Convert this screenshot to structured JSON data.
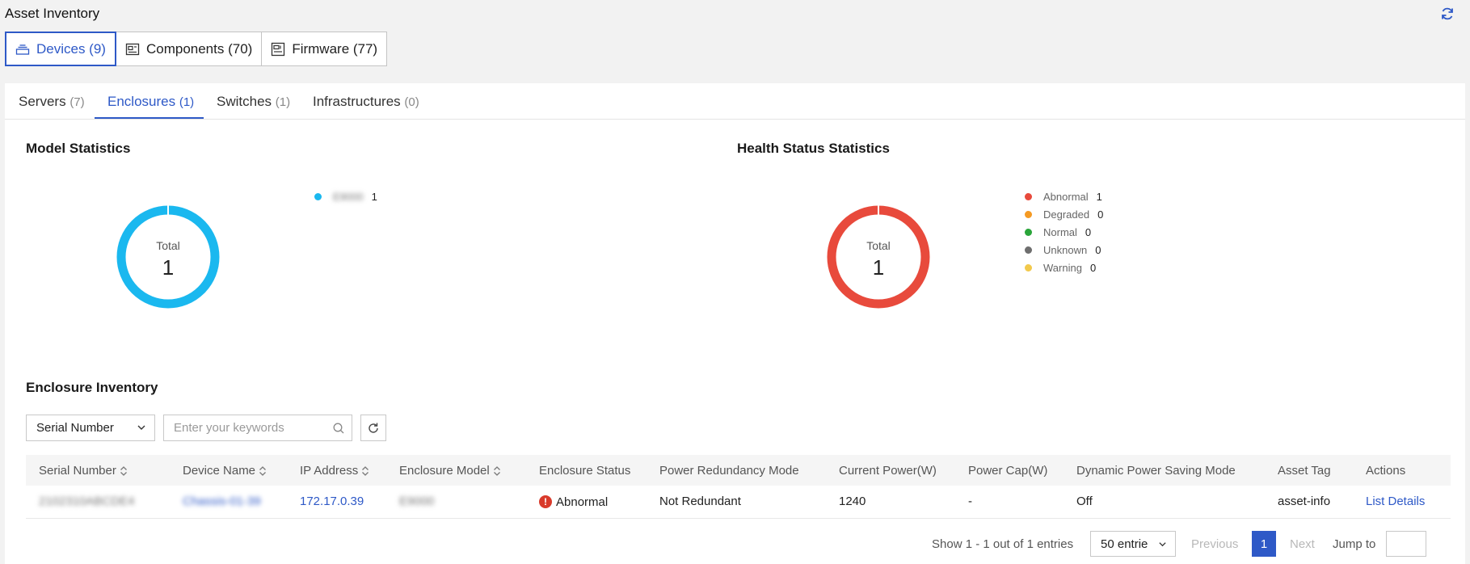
{
  "header": {
    "title": "Asset Inventory",
    "refresh_icon": "refresh-icon"
  },
  "top_tabs": [
    {
      "label": "Devices (9)",
      "icon": "devices-icon",
      "active": true
    },
    {
      "label": "Components (70)",
      "icon": "components-icon",
      "active": false
    },
    {
      "label": "Firmware (77)",
      "icon": "firmware-icon",
      "active": false
    }
  ],
  "sub_tabs": [
    {
      "label": "Servers",
      "count": "(7)",
      "active": false
    },
    {
      "label": "Enclosures",
      "count": "(1)",
      "active": true
    },
    {
      "label": "Switches",
      "count": "(1)",
      "active": false
    },
    {
      "label": "Infrastructures",
      "count": "(0)",
      "active": false
    }
  ],
  "model_stats": {
    "title": "Model Statistics",
    "total_label": "Total",
    "total_value": "1",
    "legend": [
      {
        "name": "E9000",
        "value": "1",
        "color": "#1ab8ef"
      }
    ]
  },
  "health_stats": {
    "title": "Health Status Statistics",
    "total_label": "Total",
    "total_value": "1",
    "legend": [
      {
        "name": "Abnormal",
        "value": "1",
        "color": "#e84a3c"
      },
      {
        "name": "Degraded",
        "value": "0",
        "color": "#f59a23"
      },
      {
        "name": "Normal",
        "value": "0",
        "color": "#2aa53a"
      },
      {
        "name": "Unknown",
        "value": "0",
        "color": "#6e6e6e"
      },
      {
        "name": "Warning",
        "value": "0",
        "color": "#f2c94c"
      }
    ]
  },
  "inventory": {
    "title": "Enclosure Inventory",
    "filter_field": "Serial Number",
    "search_placeholder": "Enter your keywords",
    "columns": [
      {
        "label": "Serial Number",
        "sortable": true
      },
      {
        "label": "Device Name",
        "sortable": true
      },
      {
        "label": "IP Address",
        "sortable": true
      },
      {
        "label": "Enclosure Model",
        "sortable": true
      },
      {
        "label": "Enclosure Status",
        "sortable": false
      },
      {
        "label": "Power Redundancy Mode",
        "sortable": false
      },
      {
        "label": "Current Power(W)",
        "sortable": false
      },
      {
        "label": "Power Cap(W)",
        "sortable": false
      },
      {
        "label": "Dynamic Power Saving Mode",
        "sortable": false
      },
      {
        "label": "Asset Tag",
        "sortable": false
      },
      {
        "label": "Actions",
        "sortable": false
      }
    ],
    "rows": [
      {
        "serial_number": "2102310ABCDE4",
        "device_name": "Chassis-01-39",
        "ip_address": "172.17.0.39",
        "enclosure_model": "E9000",
        "enclosure_status": "Abnormal",
        "power_redundancy_mode": "Not Redundant",
        "current_power": "1240",
        "power_cap": "-",
        "dynamic_power_saving_mode": "Off",
        "asset_tag": "asset-info",
        "action": "List Details"
      }
    ]
  },
  "pagination": {
    "info": "Show 1 - 1 out of 1 entries",
    "page_size": "50 entrie",
    "previous": "Previous",
    "current_page": "1",
    "next": "Next",
    "jump_label": "Jump to"
  }
}
